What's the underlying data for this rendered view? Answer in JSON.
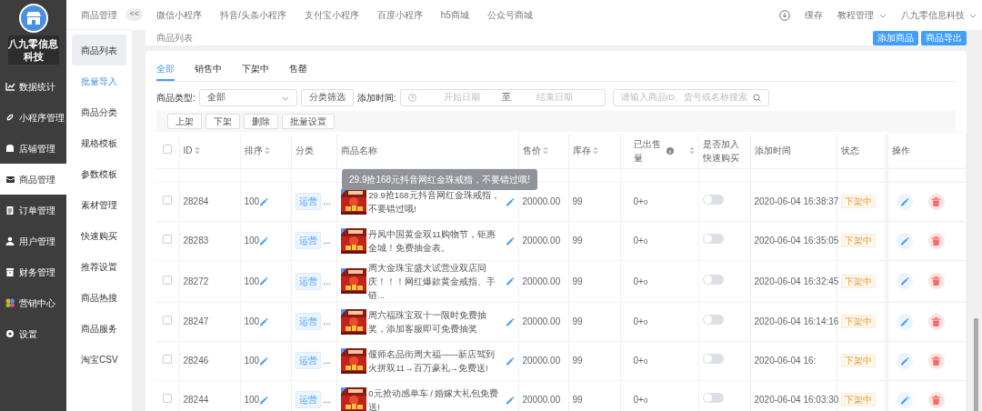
{
  "sidebar": {
    "brand": "八九零信息科技",
    "items": [
      {
        "label": "数据统计",
        "selected": false
      },
      {
        "label": "小程序管理",
        "selected": false
      },
      {
        "label": "店铺管理",
        "selected": false
      },
      {
        "label": "商品管理",
        "selected": true
      },
      {
        "label": "订单管理",
        "selected": false
      },
      {
        "label": "用户管理",
        "selected": false
      },
      {
        "label": "财务管理",
        "selected": false
      },
      {
        "label": "营销中心",
        "selected": false
      },
      {
        "label": "设置",
        "selected": false
      }
    ]
  },
  "submenu": {
    "title": "商品管理",
    "collapse": "<<",
    "items": [
      {
        "label": "商品列表",
        "selected": true,
        "highlighted": false
      },
      {
        "label": "批量导入",
        "selected": false,
        "highlighted": true
      },
      {
        "label": "商品分类",
        "selected": false,
        "highlighted": false
      },
      {
        "label": "规格模板",
        "selected": false,
        "highlighted": false
      },
      {
        "label": "参数模板",
        "selected": false,
        "highlighted": false
      },
      {
        "label": "素材管理",
        "selected": false,
        "highlighted": false
      },
      {
        "label": "快速购买",
        "selected": false,
        "highlighted": false
      },
      {
        "label": "推荐设置",
        "selected": false,
        "highlighted": false
      },
      {
        "label": "商品热搜",
        "selected": false,
        "highlighted": false
      },
      {
        "label": "商品服务",
        "selected": false,
        "highlighted": false
      },
      {
        "label": "淘宝CSV",
        "selected": false,
        "highlighted": false
      }
    ]
  },
  "top_nav": {
    "tabs": [
      "微信小程序",
      "抖音/头条小程序",
      "支付宝小程序",
      "百度小程序",
      "h5商城",
      "公众号商城"
    ],
    "cache": "缓存",
    "tutorial": "教程管理",
    "account": "八九零信息科技"
  },
  "page": {
    "title": "商品列表",
    "buttons": [
      "添加商品",
      "商品导出"
    ]
  },
  "status_tabs": [
    {
      "label": "全部",
      "selected": true
    },
    {
      "label": "销售中",
      "selected": false
    },
    {
      "label": "下架中",
      "selected": false
    },
    {
      "label": "售罄",
      "selected": false
    }
  ],
  "filters": {
    "type_label": "商品类型:",
    "type_value": "全部",
    "category_button": "分类筛选",
    "time_label": "添加时间:",
    "start_placeholder": "开始日期",
    "separator": "至",
    "end_placeholder": "结束日期",
    "search_placeholder": "请输入商品ID、货号或名称搜索"
  },
  "bulk_actions": [
    "上架",
    "下架",
    "删除",
    "批量设置"
  ],
  "table": {
    "select_all_checked": false,
    "columns": [
      {
        "label": "ID",
        "sortable": true,
        "info": false
      },
      {
        "label": "排序",
        "sortable": true,
        "info": false
      },
      {
        "label": "分类",
        "sortable": false,
        "info": false
      },
      {
        "label": "商品名称",
        "sortable": false,
        "info": false
      },
      {
        "label": "售价",
        "sortable": true,
        "info": false
      },
      {
        "label": "库存",
        "sortable": true,
        "info": false
      },
      {
        "label": "已出售量",
        "sortable": true,
        "info": true
      },
      {
        "label": "是否加入快速购买",
        "sortable": false,
        "info": false
      },
      {
        "label": "添加时间",
        "sortable": false,
        "info": false
      },
      {
        "label": "状态",
        "sortable": false,
        "info": false
      },
      {
        "label": "操作",
        "sortable": false,
        "info": false
      }
    ],
    "tooltip": "29.9抢168元抖音网红金珠戒指，不要错过哦!",
    "rows": [
      {
        "checked": false,
        "id": "28284",
        "sort": "100",
        "category": "运营",
        "more": "...",
        "name": "29.9抢168元抖音网红金珠戒指，不要错过哦!",
        "price": "20000.00",
        "stock": "99",
        "sold": "0+",
        "sold_virtual": "0",
        "quick_buy": false,
        "added": "2020-06-04 16:38:37",
        "status": "下架中"
      },
      {
        "checked": false,
        "id": "28283",
        "sort": "100",
        "category": "运营",
        "more": "...",
        "name": "丹凤中国黄金双11购物节，钜惠全城！免费抽金表。",
        "price": "20000.00",
        "stock": "99",
        "sold": "0+",
        "sold_virtual": "0",
        "quick_buy": false,
        "added": "2020-06-04 16:35:05",
        "status": "下架中"
      },
      {
        "checked": false,
        "id": "28272",
        "sort": "100",
        "category": "运营",
        "more": "...",
        "name": "周大金珠宝盛大试营业双店同庆！！！网红爆款黄金戒指、手链...",
        "price": "20000.00",
        "stock": "99",
        "sold": "0+",
        "sold_virtual": "0",
        "quick_buy": false,
        "added": "2020-06-04 16:32:45",
        "status": "下架中"
      },
      {
        "checked": false,
        "id": "28247",
        "sort": "100",
        "category": "运营",
        "more": "...",
        "name": "周六福珠宝双十一限时免费抽奖，添加客服即可免费抽奖",
        "price": "20000.00",
        "stock": "99",
        "sold": "0+",
        "sold_virtual": "0",
        "quick_buy": false,
        "added": "2020-06-04 16:14:16",
        "status": "下架中"
      },
      {
        "checked": false,
        "id": "28246",
        "sort": "100",
        "category": "运营",
        "more": "...",
        "name": "偃师名品街周大福——新店驾到火拼双11→百万豪礼→免费送!",
        "price": "20000.00",
        "stock": "99",
        "sold": "0+",
        "sold_virtual": "0",
        "quick_buy": false,
        "added": "2020-06-04 16:",
        "status": "下架中"
      },
      {
        "checked": false,
        "id": "28244",
        "sort": "100",
        "category": "运营",
        "more": "...",
        "name": "0元抢动感单车 / 婚嫁大礼包免费送!",
        "price": "20000.00",
        "stock": "99",
        "sold": "0+",
        "sold_virtual": "0",
        "quick_buy": false,
        "added": "2020-06-04 16:03:30",
        "status": "下架中"
      }
    ]
  }
}
